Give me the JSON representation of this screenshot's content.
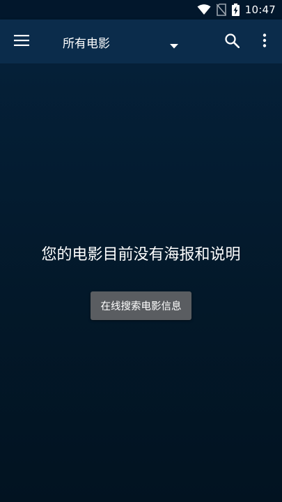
{
  "status_bar": {
    "time": "10:47",
    "icons": [
      "wifi-icon",
      "no-sim-icon",
      "battery-charging-icon"
    ]
  },
  "toolbar": {
    "menu_icon": "hamburger-menu-icon",
    "title": "所有电影",
    "dropdown_icon": "dropdown-arrow-icon",
    "search_icon": "search-icon",
    "more_icon": "more-vertical-icon"
  },
  "empty_state": {
    "message": "您的电影目前没有海报和说明",
    "button_label": "在线搜索电影信息"
  },
  "colors": {
    "status_bar": "#02172c",
    "toolbar": "#0b2c4b",
    "background": "#021426",
    "button": "#5a5d61",
    "text": "#ffffff"
  }
}
